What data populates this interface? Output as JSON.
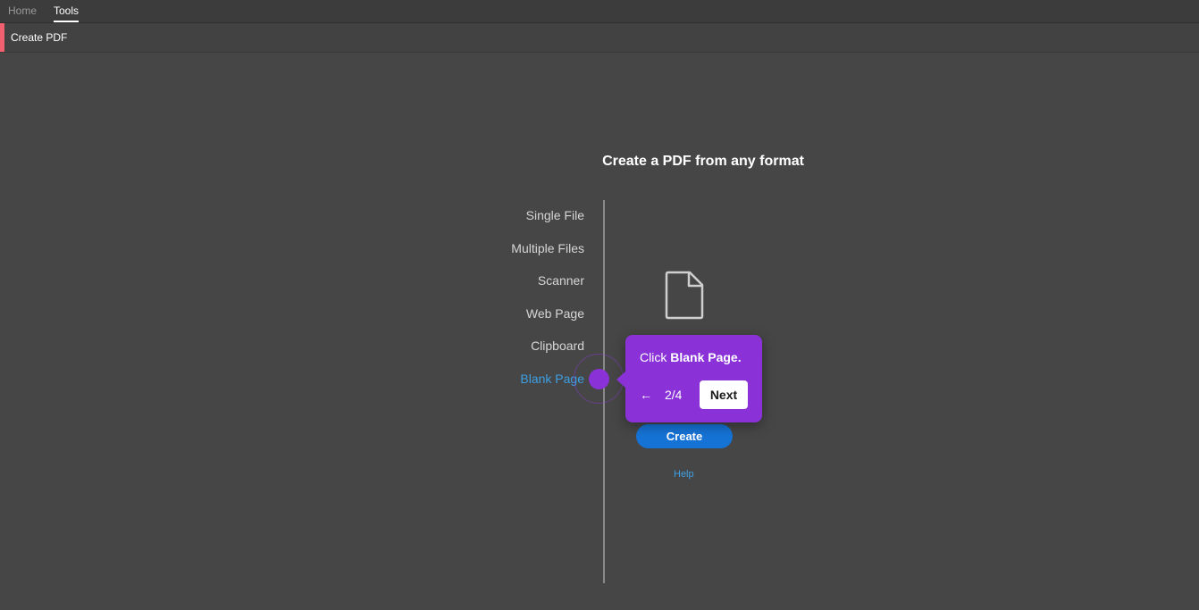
{
  "nav": {
    "tabs": [
      {
        "label": "Home"
      },
      {
        "label": "Tools"
      }
    ]
  },
  "toolbar": {
    "title": "Create PDF"
  },
  "main": {
    "headline": "Create a PDF from any format",
    "options": [
      {
        "label": "Single File"
      },
      {
        "label": "Multiple Files"
      },
      {
        "label": "Scanner"
      },
      {
        "label": "Web Page"
      },
      {
        "label": "Clipboard"
      },
      {
        "label": "Blank Page"
      }
    ],
    "create_label": "Create",
    "help_label": "Help",
    "icon": "blank-file-icon"
  },
  "tooltip": {
    "prefix": "Click ",
    "emphasis": "Blank Page.",
    "back_icon": "←",
    "step": "2/4",
    "next_label": "Next"
  },
  "colors": {
    "background": "#464646",
    "accent_red": "#f25f6e",
    "link_blue": "#3d9fe3",
    "button_blue": "#1673d6",
    "guide_purple": "#8a32d8"
  }
}
